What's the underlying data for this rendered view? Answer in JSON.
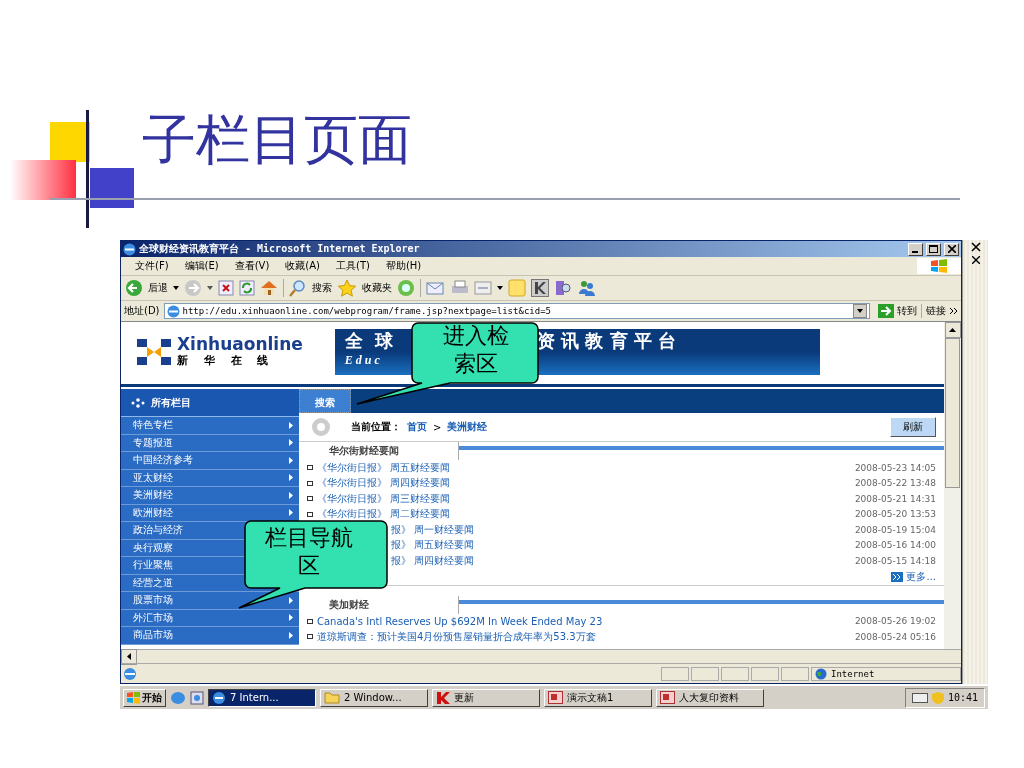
{
  "slide": {
    "title": "子栏目页面"
  },
  "browser": {
    "title": "全球财经资讯教育平台 - Microsoft Internet Explorer",
    "menu": [
      "文件(F)",
      "编辑(E)",
      "查看(V)",
      "收藏(A)",
      "工具(T)",
      "帮助(H)"
    ],
    "toolbar": {
      "back": "后退",
      "search": "搜索",
      "favorites": "收藏夹"
    },
    "address": {
      "label": "地址(D)",
      "value": "http://edu.xinhuaonline.com/webprogram/frame.jsp?nextpage=list&cid=5",
      "go": "转到",
      "links": "链接"
    },
    "status": "Internet"
  },
  "page": {
    "logo": {
      "name": "Xinhuaonline",
      "subtitle": "新 华 在 线"
    },
    "banner": {
      "left": "全  球",
      "right": "资 讯 教 育 平 台",
      "sub": "E d u c"
    },
    "sidebar": {
      "header": "所有栏目",
      "items": [
        {
          "label": "特色专栏",
          "arrow": true
        },
        {
          "label": "专题报道",
          "arrow": true
        },
        {
          "label": "中国经济参考",
          "arrow": true
        },
        {
          "label": "亚太财经",
          "arrow": true
        },
        {
          "label": "美洲财经",
          "arrow": true
        },
        {
          "label": "欧洲财经",
          "arrow": true
        },
        {
          "label": "政治与经济",
          "arrow": false
        },
        {
          "label": "央行观察",
          "arrow": false
        },
        {
          "label": "行业聚焦",
          "arrow": false
        },
        {
          "label": "经营之道",
          "arrow": false
        },
        {
          "label": "股票市场",
          "arrow": true
        },
        {
          "label": "外汇市场",
          "arrow": true
        },
        {
          "label": "商品市场",
          "arrow": true
        }
      ]
    },
    "search_tab": "搜索",
    "breadcrumb": {
      "label": "当前位置：",
      "home": "首页",
      "separator": ">",
      "current": "美洲财经"
    },
    "refresh": "刷新",
    "sections": [
      {
        "title": "华尔街财经要闻",
        "more": "更多...",
        "items": [
          {
            "title": "《华尔街日报》 周五财经要闻",
            "time": "2008-05-23 14:05"
          },
          {
            "title": "《华尔街日报》 周四财经要闻",
            "time": "2008-05-22 13:48"
          },
          {
            "title": "《华尔街日报》 周三财经要闻",
            "time": "2008-05-21 14:31"
          },
          {
            "title": "《华尔街日报》 周二财经要闻",
            "time": "2008-05-20 13:53"
          },
          {
            "title": "报》 周一财经要闻",
            "time": "2008-05-19 15:04",
            "kind": "covered"
          },
          {
            "title": "报》 周五财经要闻",
            "time": "2008-05-16 14:00",
            "kind": "covered"
          },
          {
            "title": "报》 周四财经要闻",
            "time": "2008-05-15 14:18",
            "kind": "covered"
          }
        ]
      },
      {
        "title": "美加财经",
        "items": [
          {
            "title": "Canada's Intl Reserves Up $692M In Week Ended May 23",
            "time": "2008-05-26 19:02"
          },
          {
            "title": "道琼斯调查：预计美国4月份预售屋销量折合成年率为53.3万套",
            "time": "2008-05-24 05:16"
          }
        ]
      }
    ]
  },
  "taskbar": {
    "start": "开始",
    "tasks": [
      {
        "label": "7 Intern...",
        "selected": true,
        "kind": "ie"
      },
      {
        "label": "2 Window...",
        "selected": false,
        "kind": "folder"
      },
      {
        "label": "更新",
        "selected": false,
        "kind": "k"
      },
      {
        "label": "演示文稿1",
        "selected": false,
        "kind": "ppt"
      },
      {
        "label": "人大复印资料",
        "selected": false,
        "kind": "ppt"
      }
    ],
    "clock": "10:41"
  },
  "callouts": [
    {
      "text": "进入检索区"
    },
    {
      "text": "栏目导航区"
    }
  ]
}
